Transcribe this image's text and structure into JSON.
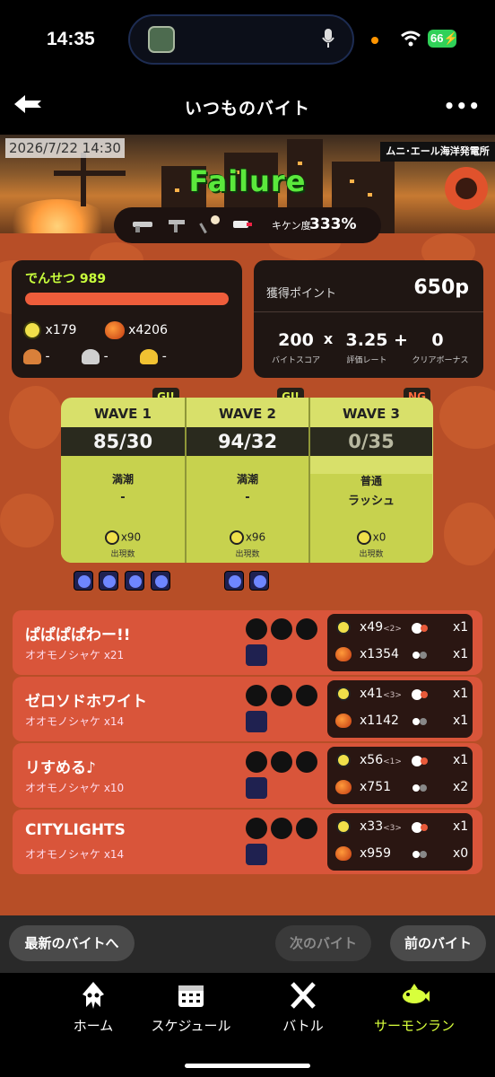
{
  "status": {
    "time": "14:35",
    "battery": "66"
  },
  "header": {
    "title": "いつものバイト",
    "more": "•••"
  },
  "banner": {
    "date": "2026/7/22 14:30",
    "stage": "ムニ･エール海洋発電所",
    "result": "Failure",
    "hazard_label": "キケン度",
    "hazard_value": "333%"
  },
  "summary": {
    "grade": "でんせつ 989",
    "golden_eggs": "x179",
    "power_eggs": "x4206",
    "scale_bronze": "-",
    "scale_silver": "-",
    "scale_gold": "-"
  },
  "points": {
    "label": "獲得ポイント",
    "value": "650p",
    "score": "200",
    "score_label": "バイトスコア",
    "times": "x",
    "rate": "3.25",
    "rate_label": "評価レート",
    "plus": "+",
    "bonus": "0",
    "bonus_label": "クリアボーナス"
  },
  "waves": [
    {
      "badge": "GJ!",
      "title": "WAVE 1",
      "quota": "85/30",
      "tide": "満潮",
      "event": "-",
      "count": "x90",
      "count_label": "出現数"
    },
    {
      "badge": "GJ!",
      "title": "WAVE 2",
      "quota": "94/32",
      "tide": "満潮",
      "event": "-",
      "count": "x96",
      "count_label": "出現数"
    },
    {
      "badge": "NG",
      "title": "WAVE 3",
      "quota": "0/35",
      "tide": "普通",
      "event": "ラッシュ",
      "count": "x0",
      "count_label": "出現数"
    }
  ],
  "players": [
    {
      "name": "ぱぱぱぱわー!!",
      "species": "オオモノシャケ x21",
      "golden": "x49",
      "assist": "<2>",
      "power": "x1354",
      "rescue": "x1",
      "rescued": "x1"
    },
    {
      "name": "ゼロソドホワイト",
      "species": "オオモノシャケ x14",
      "golden": "x41",
      "assist": "<3>",
      "power": "x1142",
      "rescue": "x1",
      "rescued": "x1"
    },
    {
      "name": "リすめる♪",
      "species": "オオモノシャケ x10",
      "golden": "x56",
      "assist": "<1>",
      "power": "x751",
      "rescue": "x1",
      "rescued": "x2"
    },
    {
      "name": "CITYLIGHTS",
      "species": "オオモノシャケ x14",
      "golden": "x33",
      "assist": "<3>",
      "power": "x959",
      "rescue": "x1",
      "rescued": "x0"
    }
  ],
  "controls": {
    "latest": "最新のバイトへ",
    "next": "次のバイト",
    "prev": "前のバイト"
  },
  "tabs": [
    {
      "label": "ホーム",
      "icon": "squid-icon"
    },
    {
      "label": "スケジュール",
      "icon": "calendar-icon"
    },
    {
      "label": "バトル",
      "icon": "crossed-weapons-icon"
    },
    {
      "label": "サーモンラン",
      "icon": "salmon-icon"
    }
  ],
  "colors": {
    "accent_green": "#5be83c",
    "active_tab": "#d8ff3c",
    "wave_bg": "#d8e06a",
    "player_row": "#d9553a"
  }
}
